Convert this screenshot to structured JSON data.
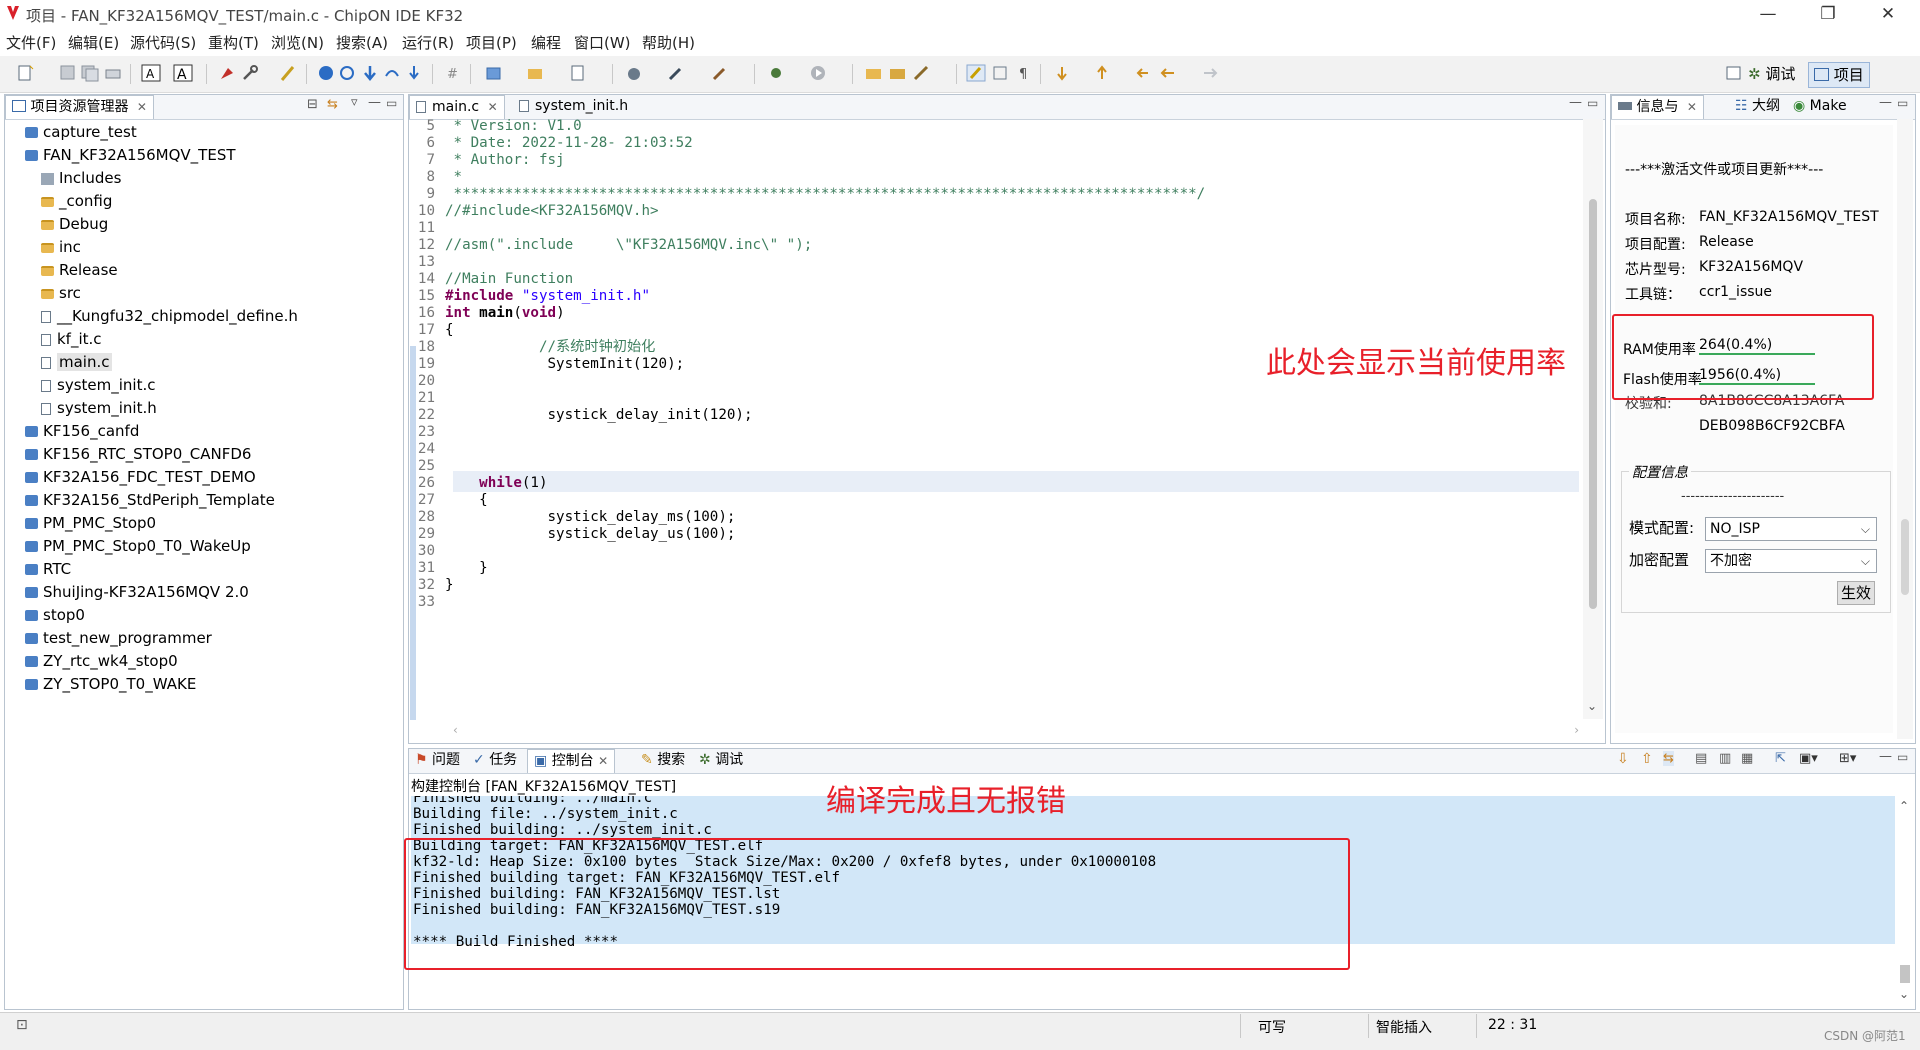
{
  "window": {
    "title": "项目 - FAN_KF32A156MQV_TEST/main.c - ChipON IDE KF32",
    "controls": [
      "—",
      "❐",
      "✕"
    ]
  },
  "menu": [
    "文件(F)",
    "编辑(E)",
    "源代码(S)",
    "重构(T)",
    "浏览(N)",
    "搜索(A)",
    "运行(R)",
    "项目(P)",
    "编程",
    "窗口(W)",
    "帮助(H)"
  ],
  "perspectives": {
    "debug": "调试",
    "project": "项目"
  },
  "explorer": {
    "title": "项目资源管理器",
    "items": [
      {
        "label": "capture_test",
        "type": "project",
        "indent": 0
      },
      {
        "label": "FAN_KF32A156MQV_TEST",
        "type": "project",
        "indent": 0
      },
      {
        "label": "Includes",
        "type": "includes",
        "indent": 1
      },
      {
        "label": "_config",
        "type": "folder",
        "indent": 1
      },
      {
        "label": "Debug",
        "type": "folder",
        "indent": 1
      },
      {
        "label": "inc",
        "type": "folder",
        "indent": 1
      },
      {
        "label": "Release",
        "type": "folder",
        "indent": 1
      },
      {
        "label": "src",
        "type": "folder",
        "indent": 1
      },
      {
        "label": "__Kungfu32_chipmodel_define.h",
        "type": "file",
        "indent": 1
      },
      {
        "label": "kf_it.c",
        "type": "file",
        "indent": 1
      },
      {
        "label": "main.c",
        "type": "file",
        "indent": 1,
        "selected": true
      },
      {
        "label": "system_init.c",
        "type": "file",
        "indent": 1
      },
      {
        "label": "system_init.h",
        "type": "file",
        "indent": 1
      },
      {
        "label": "KF156_canfd",
        "type": "project",
        "indent": 0
      },
      {
        "label": "KF156_RTC_STOP0_CANFD6",
        "type": "project",
        "indent": 0
      },
      {
        "label": "KF32A156_FDC_TEST_DEMO",
        "type": "project",
        "indent": 0
      },
      {
        "label": "KF32A156_StdPeriph_Template",
        "type": "project",
        "indent": 0
      },
      {
        "label": "PM_PMC_Stop0",
        "type": "project",
        "indent": 0
      },
      {
        "label": "PM_PMC_Stop0_T0_WakeUp",
        "type": "project",
        "indent": 0
      },
      {
        "label": "RTC",
        "type": "project",
        "indent": 0
      },
      {
        "label": "ShuiJing-KF32A156MQV 2.0",
        "type": "project",
        "indent": 0
      },
      {
        "label": "stop0",
        "type": "project",
        "indent": 0
      },
      {
        "label": "test_new_programmer",
        "type": "project",
        "indent": 0
      },
      {
        "label": "ZY_rtc_wk4_stop0",
        "type": "project",
        "indent": 0
      },
      {
        "label": "ZY_STOP0_T0_WAKE",
        "type": "project",
        "indent": 0
      }
    ]
  },
  "editor": {
    "tabs": [
      "main.c",
      "system_init.h"
    ],
    "lines": [
      {
        "n": "5",
        "segs": [
          {
            "t": " * Version: V1.0",
            "c": "cmt"
          }
        ]
      },
      {
        "n": "6",
        "segs": [
          {
            "t": " * Date: 2022-11-28- 21:03:52",
            "c": "cmt"
          }
        ]
      },
      {
        "n": "7",
        "segs": [
          {
            "t": " * Author: fsj",
            "c": "cmt"
          }
        ]
      },
      {
        "n": "8",
        "segs": [
          {
            "t": " *",
            "c": "cmt"
          }
        ]
      },
      {
        "n": "9",
        "segs": [
          {
            "t": " ***************************************************************************************/",
            "c": "cmt"
          }
        ]
      },
      {
        "n": "10",
        "segs": [
          {
            "t": "//#include<KF32A156MQV.h>",
            "c": "cmt"
          }
        ]
      },
      {
        "n": "11",
        "segs": []
      },
      {
        "n": "12",
        "segs": [
          {
            "t": "//asm(\".include     \\\"KF32A156MQV.inc\\\" \");",
            "c": "cmt"
          }
        ]
      },
      {
        "n": "13",
        "segs": []
      },
      {
        "n": "14",
        "segs": [
          {
            "t": "//Main Function",
            "c": "cmt"
          }
        ]
      },
      {
        "n": "15",
        "segs": [
          {
            "t": "#include ",
            "c": "kw"
          },
          {
            "t": "\"system_init.h\"",
            "c": "str"
          }
        ]
      },
      {
        "n": "16",
        "segs": [
          {
            "t": "int ",
            "c": "kw"
          },
          {
            "t": "main",
            "c": "b"
          },
          {
            "t": "(",
            "c": ""
          },
          {
            "t": "void",
            "c": "kw"
          },
          {
            "t": ")",
            "c": ""
          }
        ]
      },
      {
        "n": "17",
        "segs": [
          {
            "t": "{",
            "c": ""
          }
        ]
      },
      {
        "n": "18",
        "segs": [
          {
            "t": "           //系统时钟初始化",
            "c": "cmt"
          }
        ]
      },
      {
        "n": "19",
        "segs": [
          {
            "t": "            SystemInit(120);",
            "c": ""
          }
        ]
      },
      {
        "n": "20",
        "segs": []
      },
      {
        "n": "21",
        "segs": []
      },
      {
        "n": "22",
        "segs": [
          {
            "t": "            systick_delay_init(120);",
            "c": "hl"
          }
        ]
      },
      {
        "n": "23",
        "segs": []
      },
      {
        "n": "24",
        "segs": []
      },
      {
        "n": "25",
        "segs": []
      },
      {
        "n": "26",
        "segs": [
          {
            "t": "    ",
            "c": ""
          },
          {
            "t": "while",
            "c": "kw"
          },
          {
            "t": "(1)",
            "c": ""
          }
        ]
      },
      {
        "n": "27",
        "segs": [
          {
            "t": "    {",
            "c": ""
          }
        ]
      },
      {
        "n": "28",
        "segs": [
          {
            "t": "            systick_delay_ms(100);",
            "c": ""
          }
        ]
      },
      {
        "n": "29",
        "segs": [
          {
            "t": "            systick_delay_us(100);",
            "c": ""
          }
        ]
      },
      {
        "n": "30",
        "segs": []
      },
      {
        "n": "31",
        "segs": [
          {
            "t": "    }",
            "c": ""
          }
        ]
      },
      {
        "n": "32",
        "segs": [
          {
            "t": "}",
            "c": ""
          }
        ]
      },
      {
        "n": "33",
        "segs": []
      }
    ]
  },
  "info_panel": {
    "tabs": [
      "信息与",
      "大纲",
      "Make"
    ],
    "header": "---***激活文件或项目更新***---",
    "rows": [
      {
        "label": "项目名称:",
        "value": "FAN_KF32A156MQV_TEST"
      },
      {
        "label": "项目配置:",
        "value": "Release"
      },
      {
        "label": "芯片型号:",
        "value": "KF32A156MQV"
      },
      {
        "label": "工具链：",
        "value": "ccr1_issue"
      }
    ],
    "ram_label": "RAM使用率",
    "ram_value": "264(0.4%)",
    "flash_label": "Flash使用率",
    "flash_value": "1956(0.4%)",
    "checksum_label": "校验和:",
    "checksum_1": "8A1B86CC8A13A6FA",
    "checksum_2": "DEB098B6CF92CBFA",
    "config_title": "配置信息",
    "config_divider": "----------------------",
    "mode_label": "模式配置:",
    "mode_value": "NO_ISP",
    "enc_label": "加密配置",
    "enc_value": "不加密",
    "apply_button": "生效"
  },
  "console": {
    "tabs": [
      "问题",
      "任务",
      "控制台",
      "搜索",
      "调试"
    ],
    "title": "构建控制台 [FAN_KF32A156MQV_TEST]",
    "lines": [
      "Finished building: ../main.c",
      "Building file: ../system_init.c",
      "Finished building: ../system_init.c",
      "Building target: FAN_KF32A156MQV_TEST.elf",
      "kf32-ld: Heap Size: 0x100 bytes  Stack Size/Max: 0x200 / 0xfef8 bytes, under 0x10000108",
      "Finished building target: FAN_KF32A156MQV_TEST.elf",
      "Finished building: FAN_KF32A156MQV_TEST.lst",
      "Finished building: FAN_KF32A156MQV_TEST.s19",
      "",
      "**** Build Finished ****"
    ]
  },
  "annotations": {
    "usage": "此处会显示当前使用率",
    "build": "编译完成且无报错",
    "color": "#e8202a"
  },
  "status": {
    "writable": "可写",
    "insert": "智能插入",
    "position": "22 : 31",
    "watermark": "CSDN @阿范1"
  }
}
